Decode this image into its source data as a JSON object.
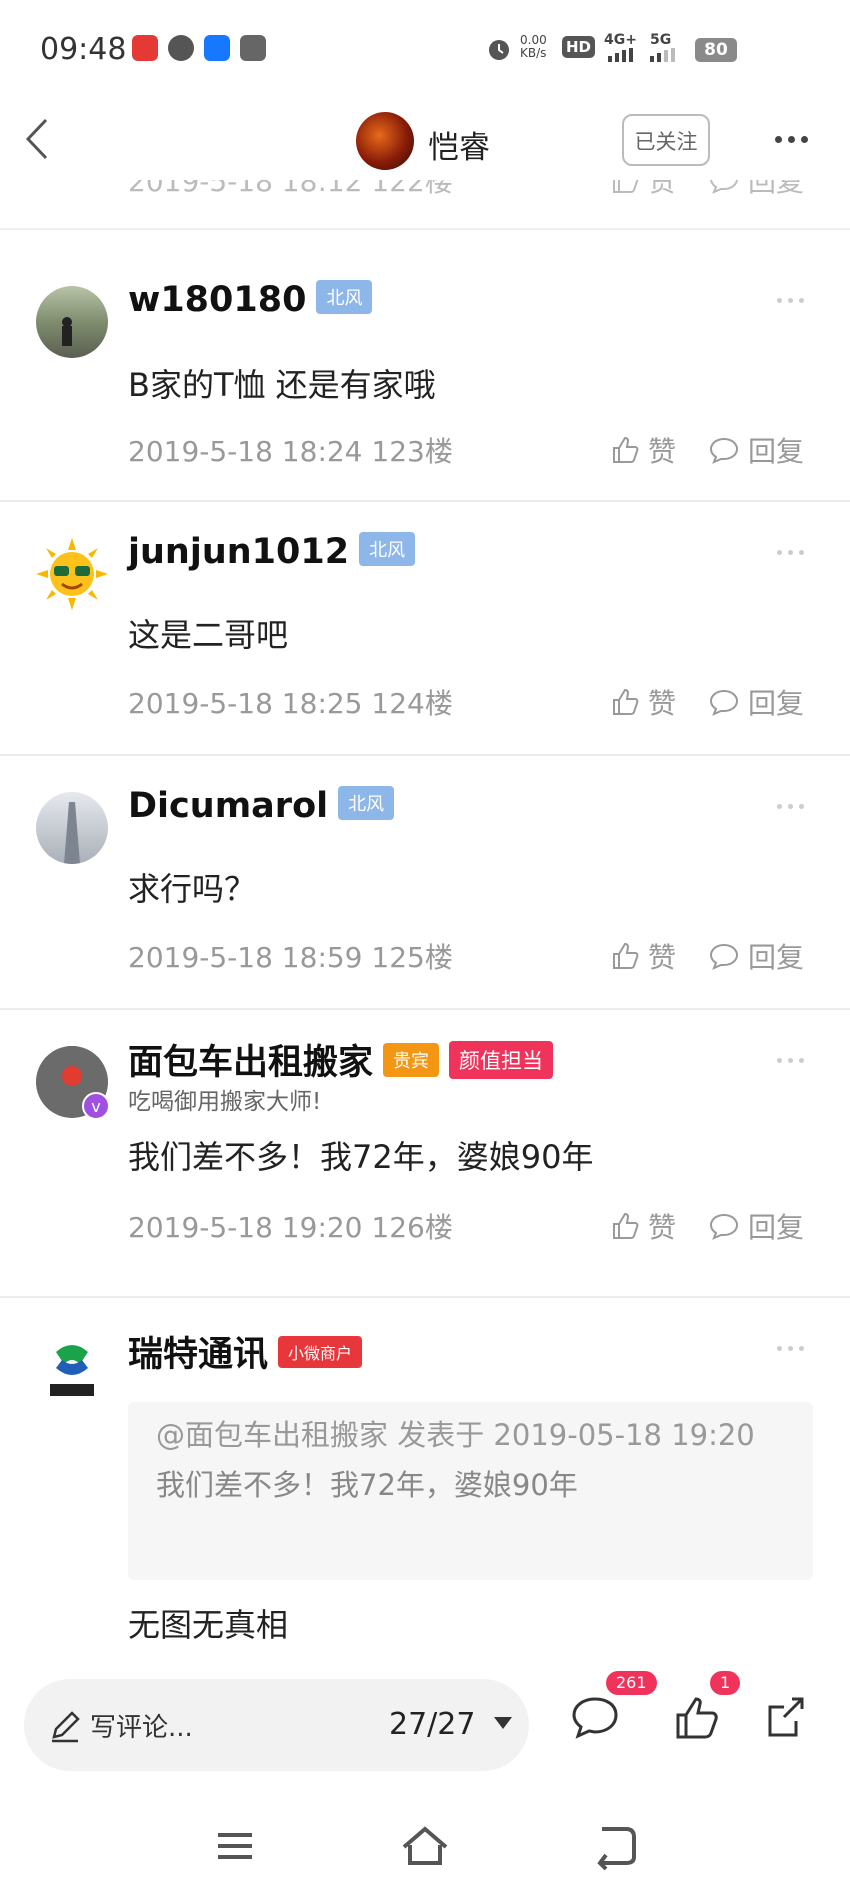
{
  "status_bar": {
    "time": "09:48",
    "net_speed": "0.00\nKB/s",
    "network_a": "4G+",
    "network_b": "5G",
    "hd": "HD",
    "battery": "80"
  },
  "header": {
    "author_name": "恺睿",
    "follow_label": "已关注"
  },
  "partial_row": {
    "meta": "2019-5-18 18:12  122楼",
    "like_label": "赞",
    "reply_label": "回复"
  },
  "comments": [
    {
      "username": "w180180",
      "badges": [
        "北风"
      ],
      "text": "B家的T恤    还是有家哦",
      "meta": "2019-5-18 18:24  123楼",
      "like_label": "赞",
      "reply_label": "回复"
    },
    {
      "username": "junjun1012",
      "badges": [
        "北风"
      ],
      "text": "这是二哥吧",
      "meta": "2019-5-18 18:25  124楼",
      "like_label": "赞",
      "reply_label": "回复"
    },
    {
      "username": "Dicumarol",
      "badges": [
        "北风"
      ],
      "text": "求行吗？",
      "meta": "2019-5-18 18:59  125楼",
      "like_label": "赞",
      "reply_label": "回复"
    },
    {
      "username": "面包车出租搬家",
      "badges": [
        "贵宾",
        "颜值担当"
      ],
      "subtitle": "吃喝御用搬家大师!",
      "text": "我们差不多！我72年，婆娘90年",
      "meta": "2019-5-18 19:20  126楼",
      "like_label": "赞",
      "reply_label": "回复"
    },
    {
      "username": "瑞特通讯",
      "badges": [
        "小微商户"
      ],
      "quote_header": "@面包车出租搬家 发表于 2019-05-18 19:20",
      "quote_text": "我们差不多！我72年，婆娘90年",
      "text": "无图无真相"
    }
  ],
  "bottom_bar": {
    "input_placeholder": "写评论...",
    "page_indicator": "27/27",
    "comment_count": "261",
    "like_count": "1"
  },
  "colors": {
    "badge_beifeng": "#8db7e8",
    "badge_vip": "#f39614",
    "badge_yanzhi": "#f0335b",
    "count_badge": "#f0335b"
  }
}
